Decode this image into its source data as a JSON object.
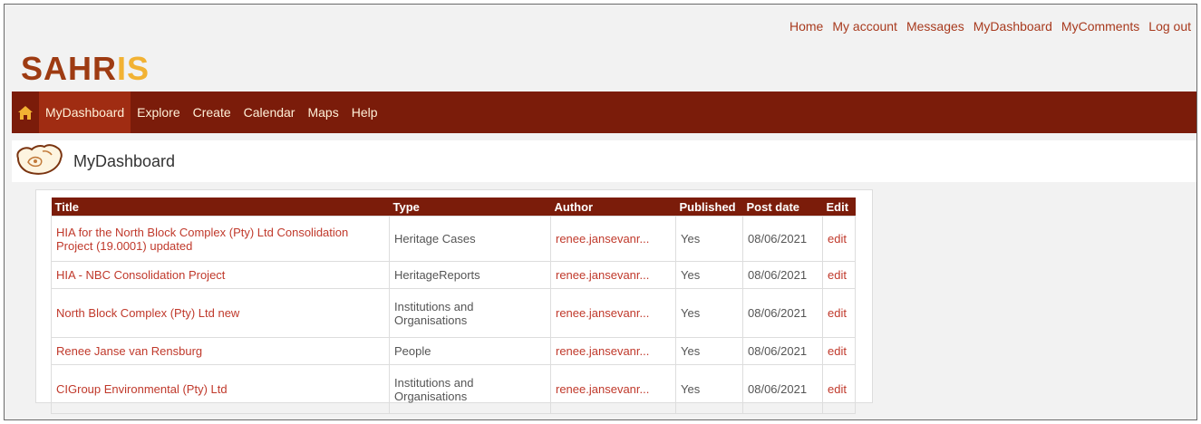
{
  "top_links": [
    "Home",
    "My account",
    "Messages",
    "MyDashboard",
    "MyComments",
    "Log out"
  ],
  "logo": {
    "part1": "SAHR",
    "part2": "IS"
  },
  "nav": {
    "tabs": [
      "MyDashboard",
      "Explore",
      "Create",
      "Calendar",
      "Maps",
      "Help"
    ],
    "active": "MyDashboard"
  },
  "page_title": "MyDashboard",
  "table": {
    "headers": [
      "Title",
      "Type",
      "Author",
      "Published",
      "Post date",
      "Edit"
    ],
    "rows": [
      {
        "title": "HIA for the North Block Complex (Pty) Ltd Consolidation Project (19.0001)",
        "badge": "updated",
        "type": "Heritage Cases",
        "author": "renee.jansevanr...",
        "published": "Yes",
        "post_date": "08/06/2021",
        "edit": "edit"
      },
      {
        "title": "HIA - NBC Consolidation Project",
        "badge": "",
        "type": "HeritageReports",
        "author": "renee.jansevanr...",
        "published": "Yes",
        "post_date": "08/06/2021",
        "edit": "edit"
      },
      {
        "title": "North Block Complex (Pty) Ltd",
        "badge": "new",
        "type": "Institutions and Organisations",
        "author": "renee.jansevanr...",
        "published": "Yes",
        "post_date": "08/06/2021",
        "edit": "edit"
      },
      {
        "title": "Renee Janse van Rensburg",
        "badge": "",
        "type": "People",
        "author": "renee.jansevanr...",
        "published": "Yes",
        "post_date": "08/06/2021",
        "edit": "edit"
      },
      {
        "title": "CIGroup Environmental (Pty) Ltd",
        "badge": "",
        "type": "Institutions and Organisations",
        "author": "renee.jansevanr...",
        "published": "Yes",
        "post_date": "08/06/2021",
        "edit": "edit"
      }
    ]
  }
}
